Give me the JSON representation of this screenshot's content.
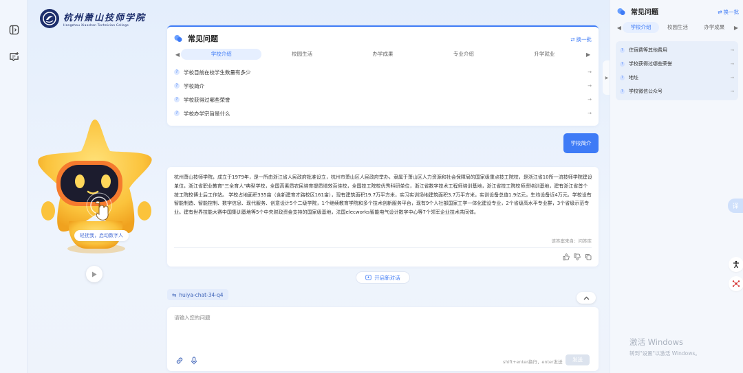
{
  "logo": {
    "name_cn": "杭州萧山技师学院",
    "name_en": "Hangzhou Xiaoshan Technician College"
  },
  "mascot": {
    "cta_label": "轻抚我，启动数字人"
  },
  "faq": {
    "title": "常见问题",
    "refresh_label": "换一批",
    "tabs": [
      "学校介绍",
      "校园生活",
      "办学成果",
      "专业介绍",
      "升学就业"
    ],
    "items": [
      "学校目前在校学生数量有多少",
      "学校简介",
      "学校获得过哪些荣誉",
      "学校办学宗旨是什么"
    ]
  },
  "chat": {
    "user_message": "学校简介",
    "answer": "杭州萧山技师学院，成立于1979年，是一所由浙江省人民政府批准设立，杭州市萧山区人民政府举办，隶属于萧山区人力资源和社会保障局的国家级重点技工院校，是浙江省10所一流技师学院建设单位，浙江省职业教育\"三全育人\"典型学校，全国高素质农民培育提质增效百佳校，全国技工院校优秀科研单位，浙江省数字技术工程师培训基地，浙江省技工院校师资培训基地，建有浙江省首个技工院校博士后工作站。 学校占地面积335亩（含新建育才路校区161亩），现有建筑面积19.7万平方米，实习实训场地建筑面积3.7万平方米，实训设备总值1.9亿元，生均设备近4万元。学校设有智能制造、智能控制、数字信息、现代服务、创意设计5个二级学院，1个继续教育学院和多个技术创新服务平台，现有9个人社部国家工学一体化建设专业，2个省级高水平专业群，3个省级示范专业。建有世界技能大赛中国集训基地等5个中央财政资金支持的国家级基地，法国elecworks智能电气设计数字中心等7个领军企业技术共同体。",
    "answer_source": "该答案来自：问答库",
    "new_chat_label": "开启新对话",
    "session_name": "huiya-chat-34-q4",
    "input_placeholder": "请输入您的问题",
    "input_hint": "shift+enter换行，enter发送",
    "send_label": "发送"
  },
  "side_faq": {
    "title": "常见问题",
    "refresh_label": "换一批",
    "tabs": [
      "学校介绍",
      "校园生活",
      "办学成果"
    ],
    "items": [
      "住宿费等其他费用",
      "学校获得过哪些荣誉",
      "地址",
      "学校微信公众号"
    ]
  },
  "floating": {
    "translate_label": "译"
  },
  "watermark": {
    "line1": "激活 Windows",
    "line2": "转到\"设置\"以激活 Windows。"
  },
  "colors": {
    "accent": "#3e7bf6",
    "mascot_yellow": "#fbc33c",
    "mascot_face": "#1c1c2e"
  }
}
